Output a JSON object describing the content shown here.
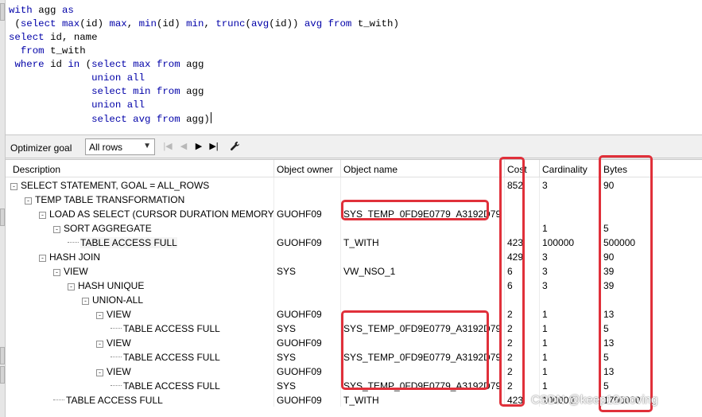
{
  "editor": {
    "lines": [
      {
        "kw": "with",
        "rest": " agg as"
      },
      {
        "kw": "",
        "rest": " (select max(id) max, min(id) min, trunc(avg(id)) avg from t_with)"
      },
      {
        "kw": "",
        "rest": "select id, name"
      },
      {
        "kw": "",
        "rest": "  from t_with"
      },
      {
        "kw": "",
        "rest": " where id in (select max from agg"
      },
      {
        "kw": "",
        "rest": "              union all"
      },
      {
        "kw": "",
        "rest": "              select min from agg"
      },
      {
        "kw": "",
        "rest": "              union all"
      },
      {
        "kw": "",
        "rest": "              select avg from agg)"
      }
    ]
  },
  "toolbar": {
    "optimizer_label": "Optimizer goal",
    "optimizer_value": "All rows",
    "first_icon": "first-page-icon",
    "prev_icon": "prev-icon",
    "next_icon": "next-icon",
    "last_icon": "last-page-icon",
    "wrench_icon": "wrench-icon"
  },
  "grid": {
    "columns": [
      "Description",
      "Object owner",
      "Object name",
      "Cost",
      "Cardinality",
      "Bytes"
    ],
    "rows": [
      {
        "level": 0,
        "toggle": "-",
        "desc": "SELECT STATEMENT, GOAL = ALL_ROWS",
        "owner": "",
        "name": "",
        "cost": "852",
        "card": "3",
        "bytes": "90"
      },
      {
        "level": 1,
        "toggle": "-",
        "desc": "TEMP TABLE TRANSFORMATION",
        "owner": "",
        "name": "",
        "cost": "",
        "card": "",
        "bytes": ""
      },
      {
        "level": 2,
        "toggle": "-",
        "desc": "LOAD AS SELECT (CURSOR DURATION MEMORY)",
        "owner": "GUOHF09",
        "name": "SYS_TEMP_0FD9E0779_A3192D79",
        "cost": "",
        "card": "",
        "bytes": ""
      },
      {
        "level": 3,
        "toggle": "-",
        "desc": "SORT AGGREGATE",
        "owner": "",
        "name": "",
        "cost": "",
        "card": "1",
        "bytes": "5"
      },
      {
        "level": 4,
        "toggle": "",
        "desc": "TABLE ACCESS FULL",
        "owner": "GUOHF09",
        "name": "T_WITH",
        "cost": "423",
        "card": "100000",
        "bytes": "500000",
        "highlight": true
      },
      {
        "level": 2,
        "toggle": "-",
        "desc": "HASH JOIN",
        "owner": "",
        "name": "",
        "cost": "429",
        "card": "3",
        "bytes": "90"
      },
      {
        "level": 3,
        "toggle": "-",
        "desc": "VIEW",
        "owner": "SYS",
        "name": "VW_NSO_1",
        "cost": "6",
        "card": "3",
        "bytes": "39"
      },
      {
        "level": 4,
        "toggle": "-",
        "desc": "HASH UNIQUE",
        "owner": "",
        "name": "",
        "cost": "6",
        "card": "3",
        "bytes": "39"
      },
      {
        "level": 5,
        "toggle": "-",
        "desc": "UNION-ALL",
        "owner": "",
        "name": "",
        "cost": "",
        "card": "",
        "bytes": ""
      },
      {
        "level": 6,
        "toggle": "-",
        "desc": "VIEW",
        "owner": "GUOHF09",
        "name": "",
        "cost": "2",
        "card": "1",
        "bytes": "13"
      },
      {
        "level": 7,
        "toggle": "",
        "desc": "TABLE ACCESS FULL",
        "owner": "SYS",
        "name": "SYS_TEMP_0FD9E0779_A3192D79",
        "cost": "2",
        "card": "1",
        "bytes": "5"
      },
      {
        "level": 6,
        "toggle": "-",
        "desc": "VIEW",
        "owner": "GUOHF09",
        "name": "",
        "cost": "2",
        "card": "1",
        "bytes": "13"
      },
      {
        "level": 7,
        "toggle": "",
        "desc": "TABLE ACCESS FULL",
        "owner": "SYS",
        "name": "SYS_TEMP_0FD9E0779_A3192D79",
        "cost": "2",
        "card": "1",
        "bytes": "5"
      },
      {
        "level": 6,
        "toggle": "-",
        "desc": "VIEW",
        "owner": "GUOHF09",
        "name": "",
        "cost": "2",
        "card": "1",
        "bytes": "13"
      },
      {
        "level": 7,
        "toggle": "",
        "desc": "TABLE ACCESS FULL",
        "owner": "SYS",
        "name": "SYS_TEMP_0FD9E0779_A3192D79",
        "cost": "2",
        "card": "1",
        "bytes": "5"
      },
      {
        "level": 3,
        "toggle": "",
        "desc": "TABLE ACCESS FULL",
        "owner": "GUOHF09",
        "name": "T_WITH",
        "cost": "423",
        "card": "100000",
        "bytes": "1700000"
      }
    ]
  },
  "annotation_color": "#e0303a",
  "watermark": "CSDN @keep12moving"
}
